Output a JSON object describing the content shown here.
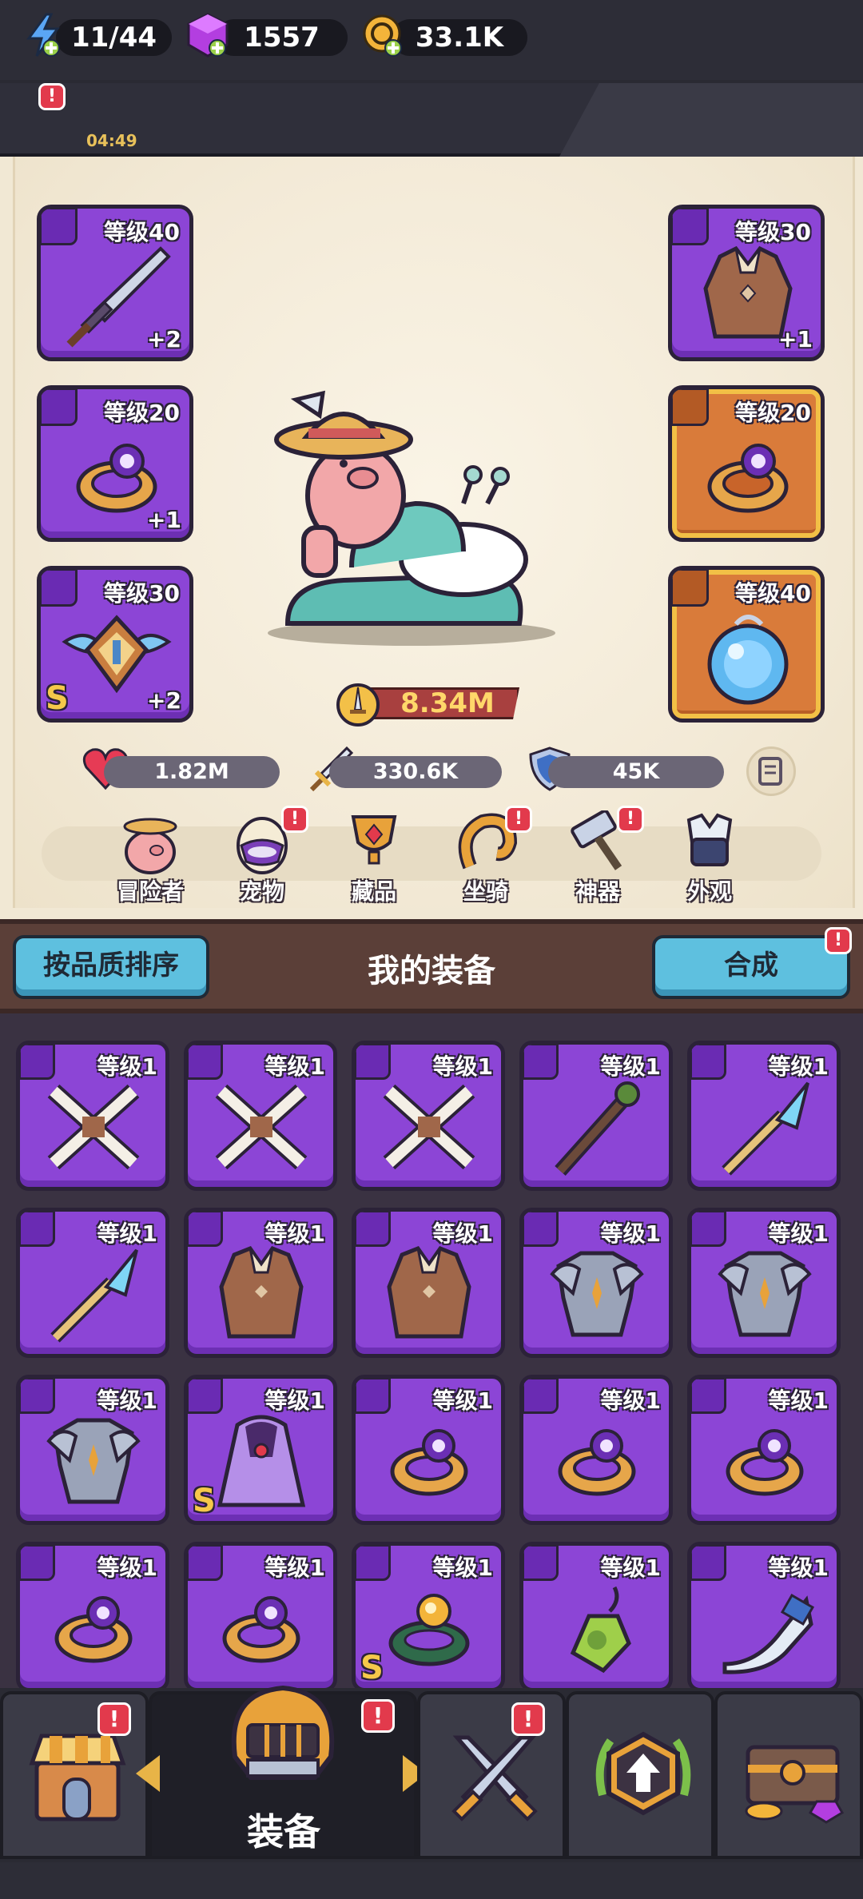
{
  "resources": {
    "energy": "11/44",
    "energy_timer": "04:49",
    "gems": "1557",
    "coins": "33.1K"
  },
  "equipped": {
    "left": [
      {
        "level": "等级40",
        "plus": "+2",
        "kind": "sword"
      },
      {
        "level": "等级20",
        "plus": "+1",
        "kind": "ring"
      },
      {
        "level": "等级30",
        "plus": "+2",
        "kind": "amulet",
        "rank": "S"
      }
    ],
    "right": [
      {
        "level": "等级30",
        "plus": "+1",
        "kind": "armor"
      },
      {
        "level": "等级20",
        "plus": "",
        "kind": "ring"
      },
      {
        "level": "等级40",
        "plus": "",
        "kind": "orb"
      }
    ]
  },
  "power": "8.34M",
  "stats": {
    "hp": "1.82M",
    "attack": "330.6K",
    "defense": "45K"
  },
  "categories": [
    "冒险者",
    "宠物",
    "藏品",
    "坐骑",
    "神器",
    "外观"
  ],
  "header": {
    "sort_label": "按品质排序",
    "title": "我的装备",
    "merge_label": "合成"
  },
  "inventory": [
    {
      "level": "等级1",
      "kind": "bones"
    },
    {
      "level": "等级1",
      "kind": "bones"
    },
    {
      "level": "等级1",
      "kind": "bones"
    },
    {
      "level": "等级1",
      "kind": "staff"
    },
    {
      "level": "等级1",
      "kind": "wand"
    },
    {
      "level": "等级1",
      "kind": "wand"
    },
    {
      "level": "等级1",
      "kind": "vest"
    },
    {
      "level": "等级1",
      "kind": "vest"
    },
    {
      "level": "等级1",
      "kind": "plate"
    },
    {
      "level": "等级1",
      "kind": "plate"
    },
    {
      "level": "等级1",
      "kind": "plate"
    },
    {
      "level": "等级1",
      "kind": "cloak",
      "rank": "S"
    },
    {
      "level": "等级1",
      "kind": "ring"
    },
    {
      "level": "等级1",
      "kind": "ring"
    },
    {
      "level": "等级1",
      "kind": "ring"
    },
    {
      "level": "等级1",
      "kind": "ring"
    },
    {
      "level": "等级1",
      "kind": "ring"
    },
    {
      "level": "等级1",
      "kind": "ring2",
      "rank": "S"
    },
    {
      "level": "等级1",
      "kind": "pendant"
    },
    {
      "level": "等级1",
      "kind": "horn"
    }
  ],
  "nav": {
    "active_label": "装备"
  },
  "colors": {
    "epic": "#8c45d6",
    "legendary": "#d97b3a",
    "accent_blue": "#5ec0df",
    "alert": "#e23a4c"
  }
}
